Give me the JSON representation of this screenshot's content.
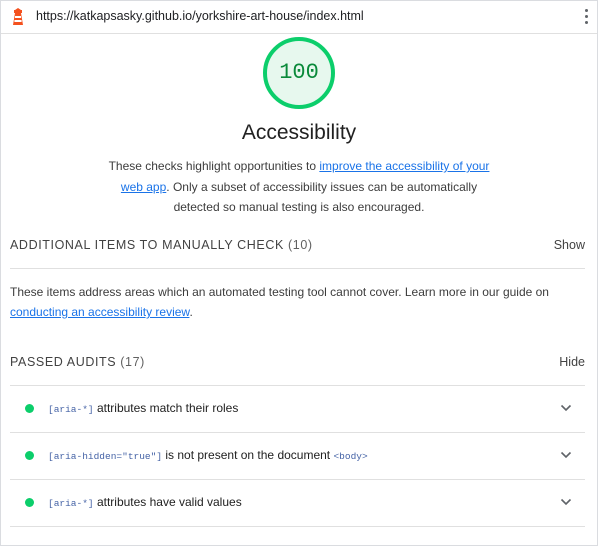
{
  "browser": {
    "url": "https://katkapsasky.github.io/yorkshire-art-house/index.html",
    "logo_icon": "lighthouse-icon",
    "menu_icon": "kebab-menu-icon"
  },
  "category": {
    "score": "100",
    "title": "Accessibility",
    "desc_before": "These checks highlight opportunities to ",
    "desc_link": "improve the accessibility of your web app",
    "desc_after": ". Only a subset of accessibility issues can be automatically detected so manual testing is also encouraged.",
    "score_color": "#0cce6b"
  },
  "manual": {
    "title": "Additional items to manually check",
    "count": "(10)",
    "toggle": "Show",
    "desc_before": "These items address areas which an automated testing tool cannot cover. Learn more in our guide on ",
    "desc_link": "conducting an accessibility review",
    "desc_after": "."
  },
  "passed": {
    "title": "Passed audits",
    "count": "(17)",
    "toggle": "Hide",
    "audits": [
      {
        "code": "[aria-*]",
        "text": " attributes match their roles",
        "code2": ""
      },
      {
        "code": "[aria-hidden=\"true\"]",
        "text": " is not present on the document ",
        "code2": "<body>"
      },
      {
        "code": "[aria-*]",
        "text": " attributes have valid values",
        "code2": ""
      }
    ]
  }
}
